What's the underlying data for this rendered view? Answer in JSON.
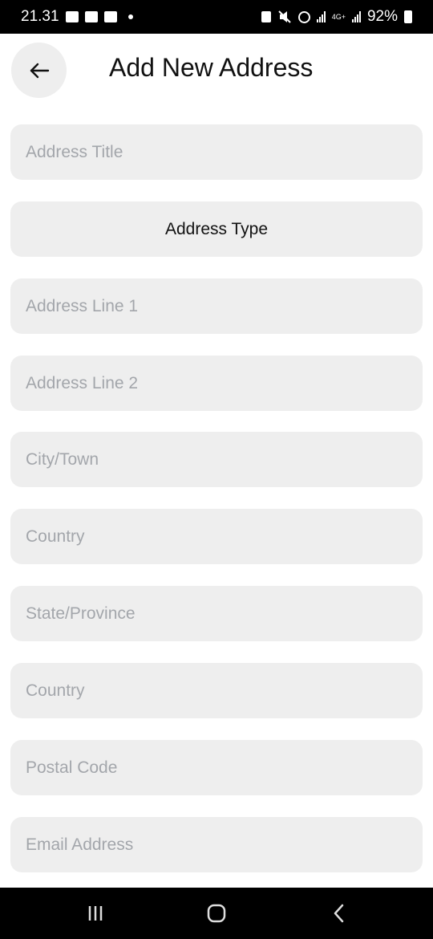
{
  "status_bar": {
    "time": "21.31",
    "network": "4G+",
    "battery": "92%"
  },
  "header": {
    "title": "Add New Address"
  },
  "form": {
    "address_title_placeholder": "Address Title",
    "address_type_label": "Address Type",
    "address_line_1_placeholder": "Address Line 1",
    "address_line_2_placeholder": "Address Line 2",
    "city_placeholder": "City/Town",
    "country_placeholder": "Country",
    "state_placeholder": "State/Province",
    "country_2_placeholder": "Country",
    "postal_code_placeholder": "Postal Code",
    "email_placeholder": "Email Address"
  },
  "icons": {
    "back": "arrow-left-icon",
    "nav_recent": "recent-apps-icon",
    "nav_home": "home-icon",
    "nav_back": "chevron-left-icon"
  },
  "colors": {
    "field_bg": "#eeeeee",
    "placeholder": "#a3a6ab",
    "text": "#111111"
  }
}
